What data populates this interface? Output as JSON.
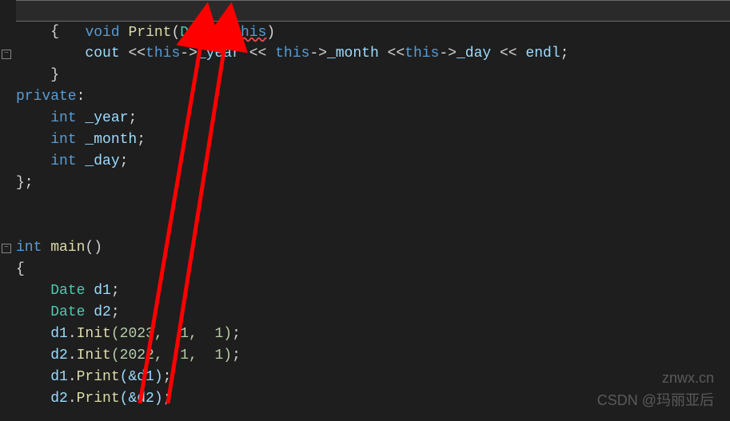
{
  "code": {
    "l1_void": "void",
    "l1_func": "Print",
    "l1_paren_open": "(",
    "l1_type": "Date",
    "l1_star": "*",
    "l1_this": "this",
    "l1_paren_close": ")",
    "l2_brace": "    {",
    "l3_indent": "        ",
    "l3_cout": "cout",
    "l3_op1": " <<",
    "l3_this1": "this",
    "l3_arrow1": "->",
    "l3_year": "_year",
    "l3_op2": " << ",
    "l3_this2": "this",
    "l3_arrow2": "->",
    "l3_month": "_month",
    "l3_op3": " <<",
    "l3_this3": "this",
    "l3_arrow3": "->",
    "l3_day": "_day",
    "l3_op4": " << ",
    "l3_endl": "endl",
    "l3_semi": ";",
    "l4_brace": "    }",
    "l5_private": "private",
    "l5_colon": ":",
    "l6_int": "    int",
    "l6_var": " _year",
    "l6_semi": ";",
    "l7_int": "    int",
    "l7_var": " _month",
    "l7_semi": ";",
    "l8_int": "    int",
    "l8_var": " _day",
    "l8_semi": ";",
    "l9_brace": "};",
    "l10": "",
    "l11": "",
    "l12_int": "int",
    "l12_main": " main",
    "l12_parens": "()",
    "l13_brace": "{",
    "l14_type": "    Date",
    "l14_var": " d1",
    "l14_semi": ";",
    "l15_type": "    Date",
    "l15_var": " d2",
    "l15_semi": ";",
    "l16_obj": "    d1",
    "l16_dot": ".",
    "l16_func": "Init",
    "l16_args": "(2023,  1,  1)",
    "l16_semi": ";",
    "l17_obj": "    d2",
    "l17_dot": ".",
    "l17_func": "Init",
    "l17_args": "(2022,  1,  1)",
    "l17_semi": ";",
    "l18_obj": "    d1",
    "l18_dot": ".",
    "l18_func": "Print",
    "l18_args": "(&d1)",
    "l18_semi": ";",
    "l19_obj": "    d2",
    "l19_dot": ".",
    "l19_func": "Print",
    "l19_args": "(&d2)",
    "l19_semi": ";"
  },
  "watermarks": {
    "wm1": "znwx.cn",
    "wm2": "CSDN @玛丽亚后"
  }
}
